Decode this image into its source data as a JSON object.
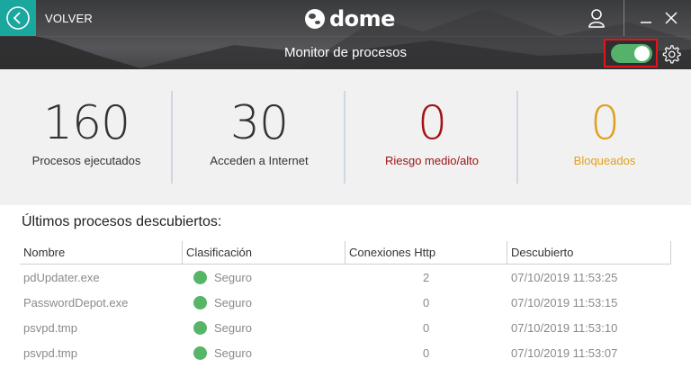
{
  "header": {
    "back_label": "VOLVER",
    "logo_text": "dome",
    "page_title": "Monitor de procesos",
    "monitor_toggle_on": true,
    "accent_color": "#1aa79d",
    "toggle_color": "#55b26a",
    "highlight_color": "#e3141c"
  },
  "stats": [
    {
      "value": "160",
      "label": "Procesos ejecutados",
      "color": "#333333"
    },
    {
      "value": "30",
      "label": "Acceden a Internet",
      "color": "#333333"
    },
    {
      "value": "0",
      "label": "Riesgo medio/alto",
      "color": "#a01414"
    },
    {
      "value": "0",
      "label": "Bloqueados",
      "color": "#e0a020"
    }
  ],
  "section_title": "Últimos procesos descubiertos:",
  "table": {
    "columns": [
      "Nombre",
      "Clasificación",
      "Conexiones Http",
      "Descubierto"
    ],
    "rows": [
      {
        "name": "pdUpdater.exe",
        "classification": "Seguro",
        "http": "2",
        "discovered": "07/10/2019 11:53:25"
      },
      {
        "name": "PasswordDepot.exe",
        "classification": "Seguro",
        "http": "0",
        "discovered": "07/10/2019 11:53:15"
      },
      {
        "name": "psvpd.tmp",
        "classification": "Seguro",
        "http": "0",
        "discovered": "07/10/2019 11:53:10"
      },
      {
        "name": "psvpd.tmp",
        "classification": "Seguro",
        "http": "0",
        "discovered": "07/10/2019 11:53:07"
      }
    ],
    "safe_color": "#57b568"
  }
}
